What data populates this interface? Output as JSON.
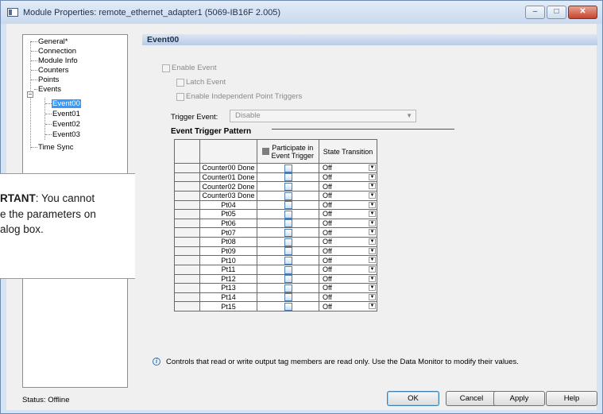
{
  "window": {
    "title": "Module Properties: remote_ethernet_adapter1 (5069-IB16F 2.005)",
    "controls": {
      "minimize": "–",
      "maximize": "□",
      "close": "✕"
    }
  },
  "tree": {
    "items": [
      {
        "label": "General*"
      },
      {
        "label": "Connection"
      },
      {
        "label": "Module Info"
      },
      {
        "label": "Counters"
      },
      {
        "label": "Points"
      },
      {
        "label": "Events"
      },
      {
        "label": "Event00"
      },
      {
        "label": "Event01"
      },
      {
        "label": "Event02"
      },
      {
        "label": "Event03"
      },
      {
        "label": "Time Sync"
      }
    ],
    "expander": "−"
  },
  "panel": {
    "title": "Event00"
  },
  "options": {
    "enable_event": "Enable Event",
    "latch_event": "Latch Event",
    "enable_independent": "Enable Independent Point Triggers"
  },
  "trigger": {
    "label": "Trigger Event:",
    "value": "Disable"
  },
  "pattern": {
    "header": "Event Trigger Pattern",
    "columns": {
      "participate_line1": "Participate in",
      "participate_line2": "Event Trigger",
      "state": "State Transition"
    },
    "rows": [
      {
        "name": "Counter00 Done",
        "state": "Off"
      },
      {
        "name": "Counter01 Done",
        "state": "Off"
      },
      {
        "name": "Counter02 Done",
        "state": "Off"
      },
      {
        "name": "Counter03 Done",
        "state": "Off"
      },
      {
        "name": "Pt04",
        "state": "Off"
      },
      {
        "name": "Pt05",
        "state": "Off"
      },
      {
        "name": "Pt06",
        "state": "Off"
      },
      {
        "name": "Pt07",
        "state": "Off"
      },
      {
        "name": "Pt08",
        "state": "Off"
      },
      {
        "name": "Pt09",
        "state": "Off"
      },
      {
        "name": "Pt10",
        "state": "Off"
      },
      {
        "name": "Pt11",
        "state": "Off"
      },
      {
        "name": "Pt12",
        "state": "Off"
      },
      {
        "name": "Pt13",
        "state": "Off"
      },
      {
        "name": "Pt14",
        "state": "Off"
      },
      {
        "name": "Pt15",
        "state": "Off"
      }
    ]
  },
  "info": {
    "icon": "i",
    "text": "Controls that read or write output tag members are read only. Use the Data Monitor to modify their values."
  },
  "status": {
    "text": "Status:  Offline"
  },
  "buttons": {
    "ok": "OK",
    "cancel": "Cancel",
    "apply": "Apply",
    "help": "Help"
  },
  "note": {
    "bold": "RTANT",
    "line1_rest": ": You cannot",
    "line2": "e the parameters on",
    "line3": "alog box."
  }
}
